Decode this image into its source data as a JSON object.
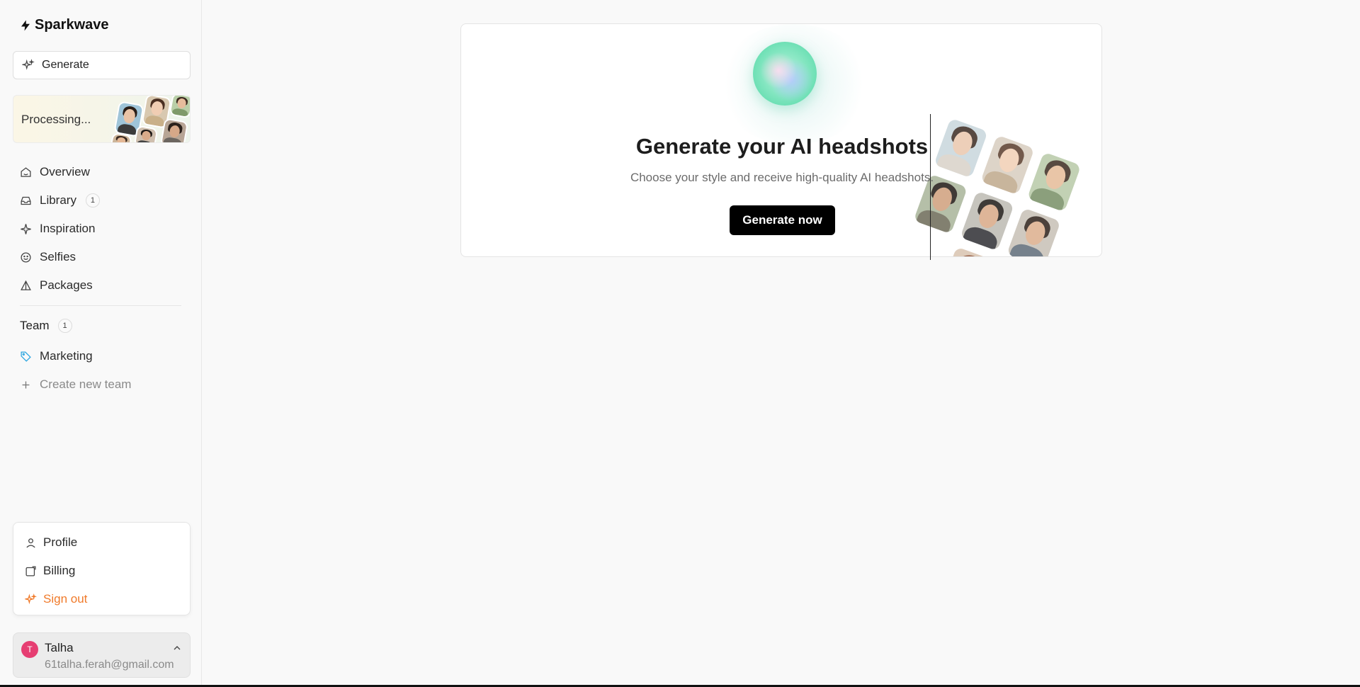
{
  "app": {
    "brand": "Sparkwave"
  },
  "sidebar": {
    "generate_label": "Generate",
    "processing_label": "Processing...",
    "nav": [
      {
        "label": "Overview",
        "icon": "home-icon"
      },
      {
        "label": "Library",
        "icon": "inbox-icon",
        "badge": "1"
      },
      {
        "label": "Inspiration",
        "icon": "sparkle-icon"
      },
      {
        "label": "Selfies",
        "icon": "smile-icon"
      },
      {
        "label": "Packages",
        "icon": "triangle-icon"
      }
    ],
    "team": {
      "label": "Team",
      "count": "1"
    },
    "teams": [
      {
        "label": "Marketing",
        "icon": "tag-icon"
      }
    ],
    "create_team_label": "Create new team",
    "account_menu": {
      "profile": "Profile",
      "billing": "Billing",
      "sign_out": "Sign out"
    },
    "user": {
      "initial": "T",
      "name": "Talha",
      "email": "61talha.ferah@gmail.com"
    }
  },
  "hero": {
    "title": "Generate your AI headshots",
    "subtitle": "Choose your style and receive high-quality AI headshots.",
    "button": "Generate now"
  },
  "colors": {
    "accent_orange": "#f07a2a",
    "avatar_pink": "#e63e72",
    "tag_blue": "#2aa5e0"
  }
}
